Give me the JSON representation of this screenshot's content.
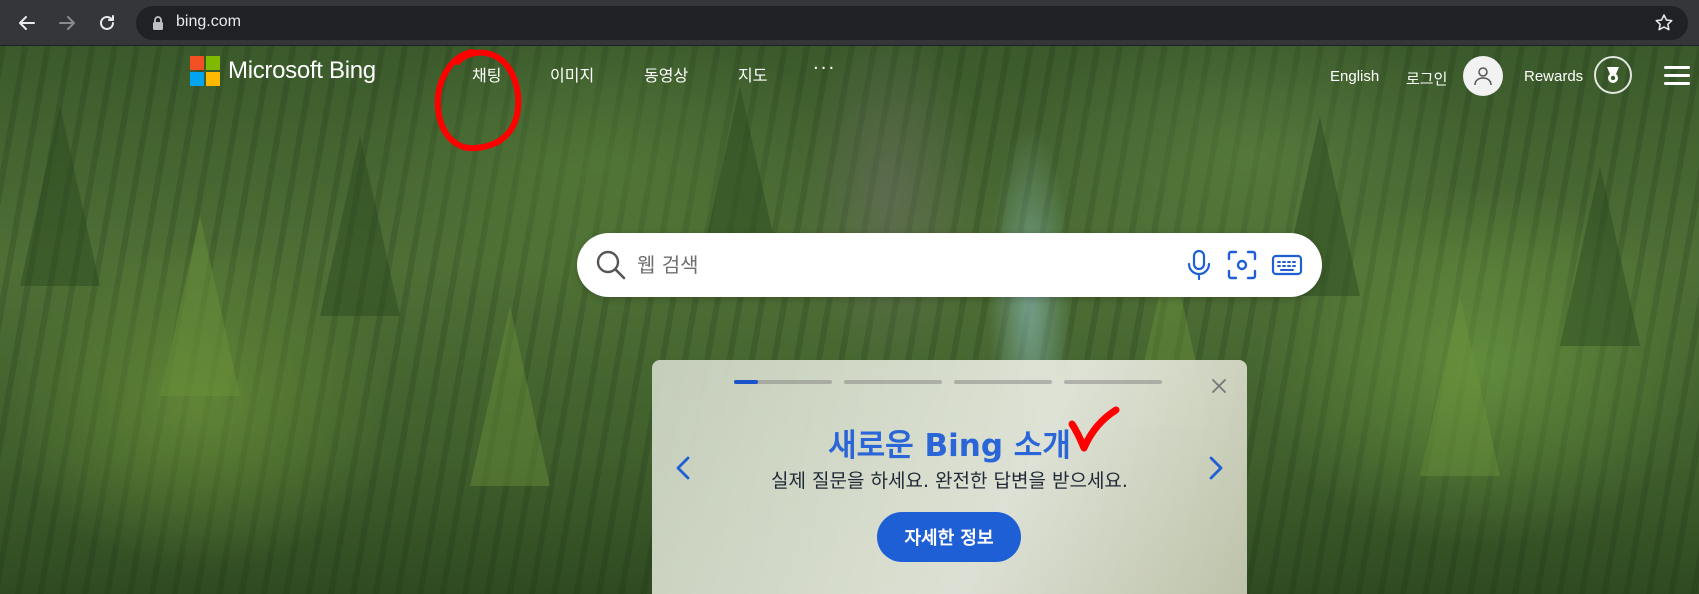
{
  "browser": {
    "url": "bing.com",
    "icons": [
      "back-arrow-icon",
      "forward-arrow-icon",
      "reload-icon",
      "lock-icon",
      "bookmark-star-icon"
    ]
  },
  "header": {
    "logo_text": "Microsoft Bing",
    "nav": [
      {
        "label": "채팅"
      },
      {
        "label": "이미지"
      },
      {
        "label": "동영상"
      },
      {
        "label": "지도"
      },
      {
        "label": "···"
      }
    ],
    "language": "English",
    "login": "로그인",
    "rewards": "Rewards"
  },
  "search": {
    "placeholder": "웹 검색",
    "tools": [
      "microphone-icon",
      "visual-search-icon",
      "keyboard-icon"
    ]
  },
  "promo": {
    "title": "새로운 Bing 소개",
    "subtitle": "실제 질문을 하세요. 완전한 답변을 받으세요.",
    "cta": "자세한 정보",
    "slides_total": 4,
    "active_slide": 1
  },
  "colors": {
    "accent": "#1f5fd6",
    "title_blue": "#2a66d8",
    "annotation_red": "#ff0000",
    "chrome_bg": "#35363a"
  }
}
